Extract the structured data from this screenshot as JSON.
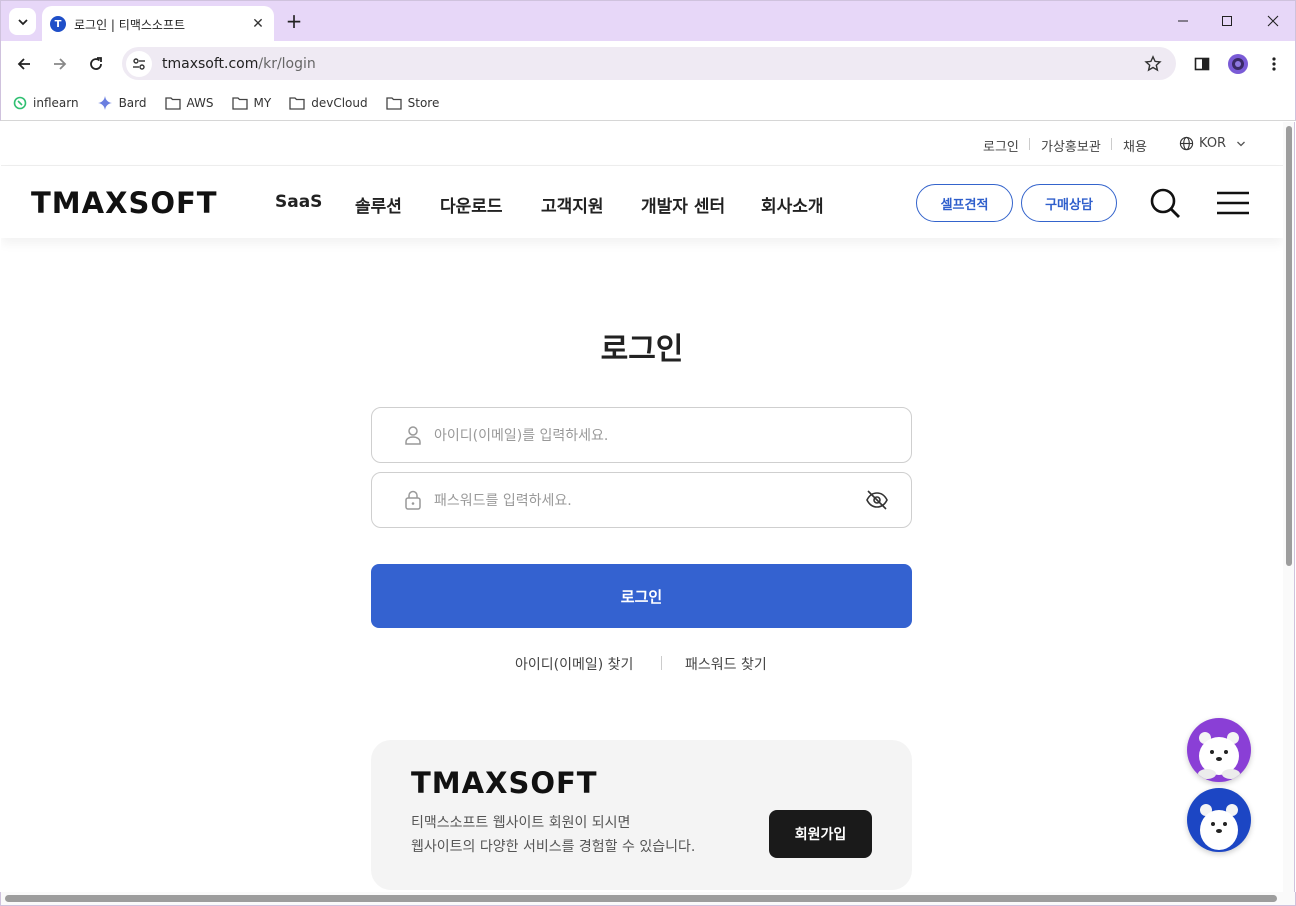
{
  "browser": {
    "tab_title": "로그인 | 티맥스소프트",
    "url_host": "tmaxsoft.com",
    "url_path": "/kr/login",
    "bookmarks": [
      "inflearn",
      "Bard",
      "AWS",
      "MY",
      "devCloud",
      "Store"
    ]
  },
  "header": {
    "util": {
      "login": "로그인",
      "pr": "가상홍보관",
      "careers": "채용",
      "language": "KOR"
    },
    "nav": [
      "SaaS",
      "솔루션",
      "다운로드",
      "고객지원",
      "개발자 센터",
      "회사소개"
    ],
    "self_estimate": "셀프견적",
    "purchase": "구매상담",
    "logo_text": "TMAXSOFT"
  },
  "login": {
    "title": "로그인",
    "id_placeholder": "아이디(이메일)를 입력하세요.",
    "pw_placeholder": "패스워드를 입력하세요.",
    "button": "로그인",
    "find_id": "아이디(이메일) 찾기",
    "find_pw": "패스워드 찾기"
  },
  "join": {
    "line1": "티맥스소프트 웹사이트 회원이 되시면",
    "line2": "웹사이트의 다양한 서비스를 경험할 수 있습니다.",
    "button": "회원가입"
  },
  "colors": {
    "accent": "#3462d0",
    "tabbar": "#e7d7f8",
    "bot1": "#8a3fd6",
    "bot2": "#1c46c4"
  }
}
